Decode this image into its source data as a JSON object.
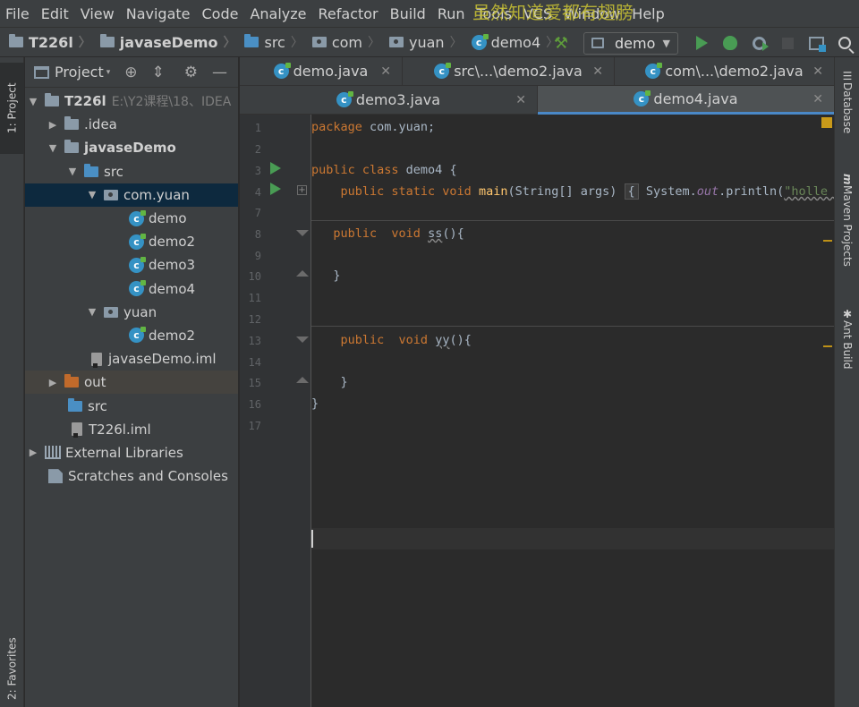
{
  "menu": [
    "File",
    "Edit",
    "View",
    "Navigate",
    "Code",
    "Analyze",
    "Refactor",
    "Build",
    "Run",
    "Tools",
    "VCS",
    "Window",
    "Help"
  ],
  "watermark": "虽然知道爱都有翅膀",
  "breadcrumb": [
    "T226l",
    "javaseDemo",
    "src",
    "com",
    "yuan",
    "demo4"
  ],
  "run_config": "demo",
  "left_tabs": {
    "project": "1: Project",
    "favorites": "2: Favorites"
  },
  "right_tabs": {
    "database": "Database",
    "maven": "Maven Projects",
    "ant": "Ant Build"
  },
  "project_panel": {
    "title": "Project"
  },
  "tree": [
    {
      "label": "T226l",
      "hint": "E:\\Y2课程\\18、IDEA"
    },
    {
      "label": ".idea"
    },
    {
      "label": "javaseDemo"
    },
    {
      "label": "src"
    },
    {
      "label": "com.yuan"
    },
    {
      "label": "demo"
    },
    {
      "label": "demo2"
    },
    {
      "label": "demo3"
    },
    {
      "label": "demo4"
    },
    {
      "label": "yuan"
    },
    {
      "label": "demo2"
    },
    {
      "label": "javaseDemo.iml"
    },
    {
      "label": "out"
    },
    {
      "label": "src"
    },
    {
      "label": "T226l.iml"
    },
    {
      "label": "External Libraries"
    },
    {
      "label": "Scratches and Consoles"
    }
  ],
  "tabs": [
    {
      "label": "demo.java"
    },
    {
      "label": "src\\...\\demo2.java"
    },
    {
      "label": "com\\...\\demo2.java"
    },
    {
      "label": "demo3.java"
    },
    {
      "label": "demo4.java"
    }
  ],
  "line_numbers": [
    "1",
    "2",
    "3",
    "4",
    "7",
    "8",
    "9",
    "10",
    "11",
    "12",
    "13",
    "14",
    "15",
    "16",
    "17"
  ],
  "code": {
    "package_kw": "package",
    "package_name": " com.yuan;",
    "class_kw": "public class",
    "class_name": " demo4 {",
    "main_kw": "public static void",
    "main_name": "main",
    "main_args": "(String[] args)",
    "main_fold": "{",
    "main_body": " System.",
    "main_out": "out",
    "main_call": ".println(",
    "main_str": "\"holle wo",
    "ss_kw": "public  void",
    "ss_name": "ss",
    "ss_rest": "(){",
    "ss_close": "}",
    "yy_kw": "public  void",
    "yy_name": "yy",
    "yy_rest": "(){",
    "yy_close": "}",
    "class_close": "}"
  }
}
